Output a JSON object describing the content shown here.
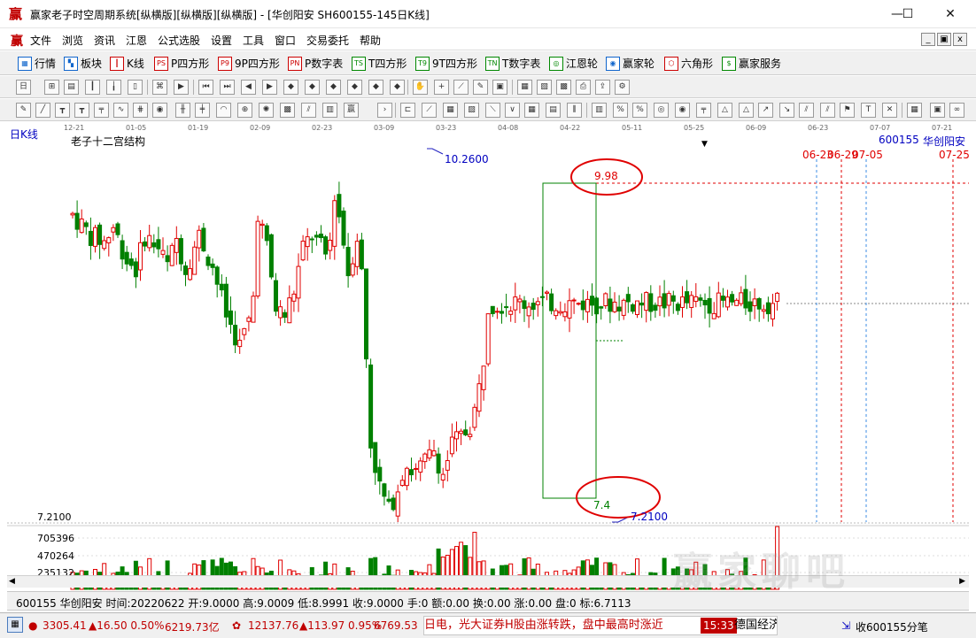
{
  "window": {
    "title": "赢家老子时空周期系统[纵横版][纵横版][纵横版] - [华创阳安 SH600155-145日K线]",
    "logo": "赢",
    "minimize": "—",
    "maximize": "☐",
    "close": "✕"
  },
  "menu": {
    "logo": "赢",
    "items": [
      "文件",
      "浏览",
      "资讯",
      "江恩",
      "公式选股",
      "设置",
      "工具",
      "窗口",
      "交易委托",
      "帮助"
    ],
    "mdi_buttons": [
      "_",
      "▣",
      "x"
    ]
  },
  "toolbar1": {
    "items": [
      {
        "label": "行情",
        "icon": "grid-icon"
      },
      {
        "label": "板块",
        "icon": "blocks-icon"
      },
      {
        "label": "K线",
        "icon": "candles-icon"
      },
      {
        "label": "P四方形",
        "icon": "ps-icon",
        "glyph": "PS"
      },
      {
        "label": "9P四方形",
        "icon": "p9-icon",
        "glyph": "P9"
      },
      {
        "label": "P数字表",
        "icon": "pn-icon",
        "glyph": "PN"
      },
      {
        "label": "T四方形",
        "icon": "ts-icon",
        "glyph": "TS"
      },
      {
        "label": "9T四方形",
        "icon": "t9-icon",
        "glyph": "T9"
      },
      {
        "label": "T数字表",
        "icon": "tn-icon",
        "glyph": "TN"
      },
      {
        "label": "江恩轮",
        "icon": "gann-wheel-icon",
        "glyph": "◎"
      },
      {
        "label": "赢家轮",
        "icon": "winner-wheel-icon",
        "glyph": "◉"
      },
      {
        "label": "六角形",
        "icon": "hexagon-icon",
        "glyph": "⬡"
      },
      {
        "label": "赢家服务",
        "icon": "dollar-icon",
        "glyph": "$"
      }
    ]
  },
  "chart": {
    "period_label": "日K线",
    "indicator_title": "老子十二宫结构",
    "stock_code": "600155",
    "stock_name": "华创阳安",
    "date_ticks": [
      "12-21",
      "01-05",
      "01-19",
      "02-09",
      "02-23",
      "03-09",
      "03-23",
      "04-08",
      "04-22",
      "05-11",
      "05-25",
      "06-09",
      "06-23",
      "07-07",
      "07-21"
    ],
    "future_dates": [
      "06-23",
      "06-29",
      "07-05",
      "07-25"
    ],
    "high_marker": "10.2600",
    "low_marker": "7.2100",
    "box_top_label": "9.98",
    "box_bottom_label": "7.4",
    "y_left_label": "7.2100",
    "volume_ticks": [
      "705396",
      "470264",
      "235132"
    ],
    "colors": {
      "up": "#e00000",
      "down": "#008000",
      "box": "#008000",
      "circle": "#e00000",
      "future": "#3c8ce6"
    }
  },
  "chart_data": {
    "type": "candlestick",
    "symbol": "600155",
    "name": "华创阳安",
    "period": "日K线",
    "max_high": 10.26,
    "min_low": 7.21,
    "box_levels": [
      9.98,
      7.4
    ],
    "reference_level": 8.9,
    "volume_scale": [
      705396,
      470264,
      235132
    ],
    "last_bar": {
      "date": "20220622",
      "open": 9.0,
      "high": 9.0009,
      "low": 8.9991,
      "close": 9.0,
      "volume": 0,
      "amount": 0.0,
      "turnover": 0.0,
      "change": 0.0
    }
  },
  "infobar": {
    "text": "600155 华创阳安 时间:20220622 开:9.0000 高:9.0009 低:8.9991 收:9.0000 手:0 额:0.00 换:0.00 涨:0.00 盘:0 标:6.7113"
  },
  "statusbar": {
    "sh_index": "3305.41",
    "sh_change": "▲16.50 0.50%",
    "sh_amount": "6219.73亿",
    "sz_index": "12137.76",
    "sz_change": "▲113.97 0.95%",
    "sz_amount": "6769.53",
    "ticker_text": "日电，光大证券H股由涨转跌，盘中最高时涨近",
    "ticker_time": "15:33",
    "ticker_source": "德国经济研究机",
    "right_text": "收600155分笔"
  },
  "watermark": "赢家聊吧"
}
